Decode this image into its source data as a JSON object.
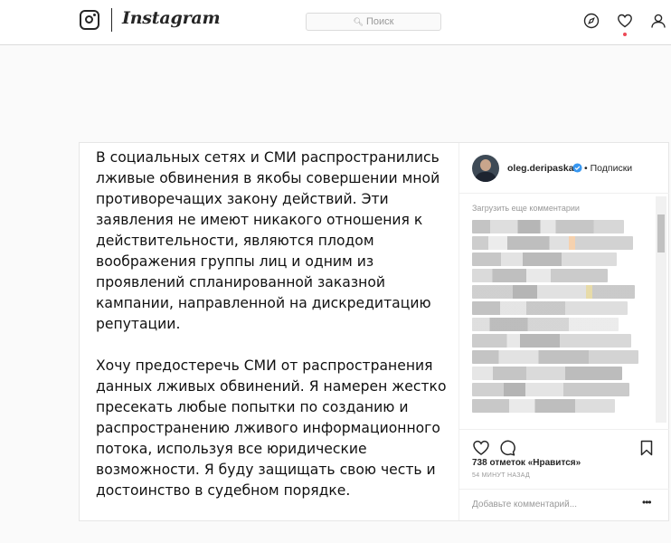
{
  "app": {
    "wordmark": "Instagram"
  },
  "search": {
    "icon": "search-icon",
    "placeholder": "Поиск"
  },
  "nav": {
    "icons": [
      "compass-icon",
      "heart-icon",
      "profile-icon"
    ],
    "notification_color": "#ed4956"
  },
  "post": {
    "caption_paragraphs": [
      "В социальных сетях и СМИ распространились лживые обвинения в якобы совершении мной противоречащих закону действий. Эти заявления не имеют никакого отношения к действительности, являются плодом воображения группы лиц и одним из проявлений спланированной заказной кампании, направленной на дискредитацию репутации.",
      "Хочу предостеречь СМИ от распространения данных лживых обвинений. Я намерен жестко пресекать любые попытки по созданию и распространению лживого информационного потока, используя все юридические возможности. Я буду защищать свою честь и достоинство в судебном порядке."
    ],
    "author": {
      "username": "oleg.deripaska",
      "verified": true,
      "separator": "•",
      "follow_label": "Подписки"
    },
    "load_more_label": "Загрузить еще комментарии",
    "likes": "738 отметок «Нравится»",
    "timestamp": "54 МИНУТ НАЗАД",
    "comment_placeholder": "Добавьте комментарий...",
    "more_label": "•••",
    "accent_verified": "#3897f0"
  }
}
